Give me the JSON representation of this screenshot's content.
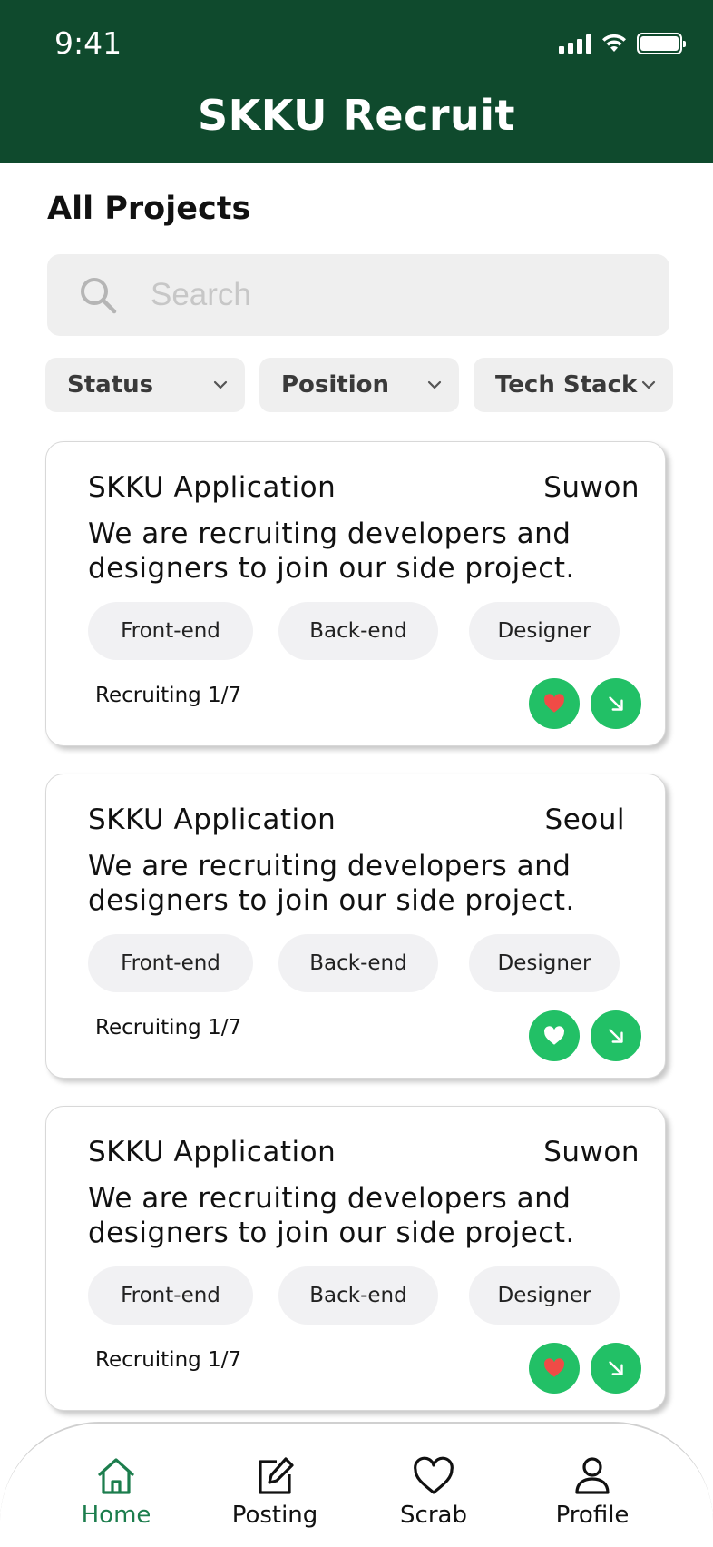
{
  "status_bar": {
    "time": "9:41"
  },
  "header": {
    "title": "SKKU Recruit"
  },
  "page": {
    "title": "All Projects"
  },
  "search": {
    "placeholder": "Search",
    "value": ""
  },
  "filters": [
    {
      "label": "Status"
    },
    {
      "label": "Position"
    },
    {
      "label": "Tech Stack"
    }
  ],
  "projects": [
    {
      "title": "SKKU Application",
      "location": "Suwon",
      "description": "We are recruiting developers and designers to join our side project.",
      "tags": [
        "Front-end",
        "Back-end",
        "Designer"
      ],
      "recruiting": "Recruiting 1/7",
      "liked": true
    },
    {
      "title": "SKKU Application",
      "location": "Seoul",
      "description": "We are recruiting developers and designers to join our side project.",
      "tags": [
        "Front-end",
        "Back-end",
        "Designer"
      ],
      "recruiting": "Recruiting 1/7",
      "liked": false
    },
    {
      "title": "SKKU Application",
      "location": "Suwon",
      "description": "We are recruiting developers and designers to join our side project.",
      "tags": [
        "Front-end",
        "Back-end",
        "Designer"
      ],
      "recruiting": "Recruiting 1/7",
      "liked": true
    }
  ],
  "tabbar": [
    {
      "label": "Home",
      "icon": "home-icon",
      "active": true
    },
    {
      "label": "Posting",
      "icon": "edit-icon",
      "active": false
    },
    {
      "label": "Scrab",
      "icon": "heart-icon",
      "active": false
    },
    {
      "label": "Profile",
      "icon": "person-icon",
      "active": false
    }
  ],
  "colors": {
    "header_bg": "#0f4a2d",
    "accent_green": "#22c066",
    "active_tab": "#1c7d4d",
    "heart_liked": "#f04b46"
  }
}
